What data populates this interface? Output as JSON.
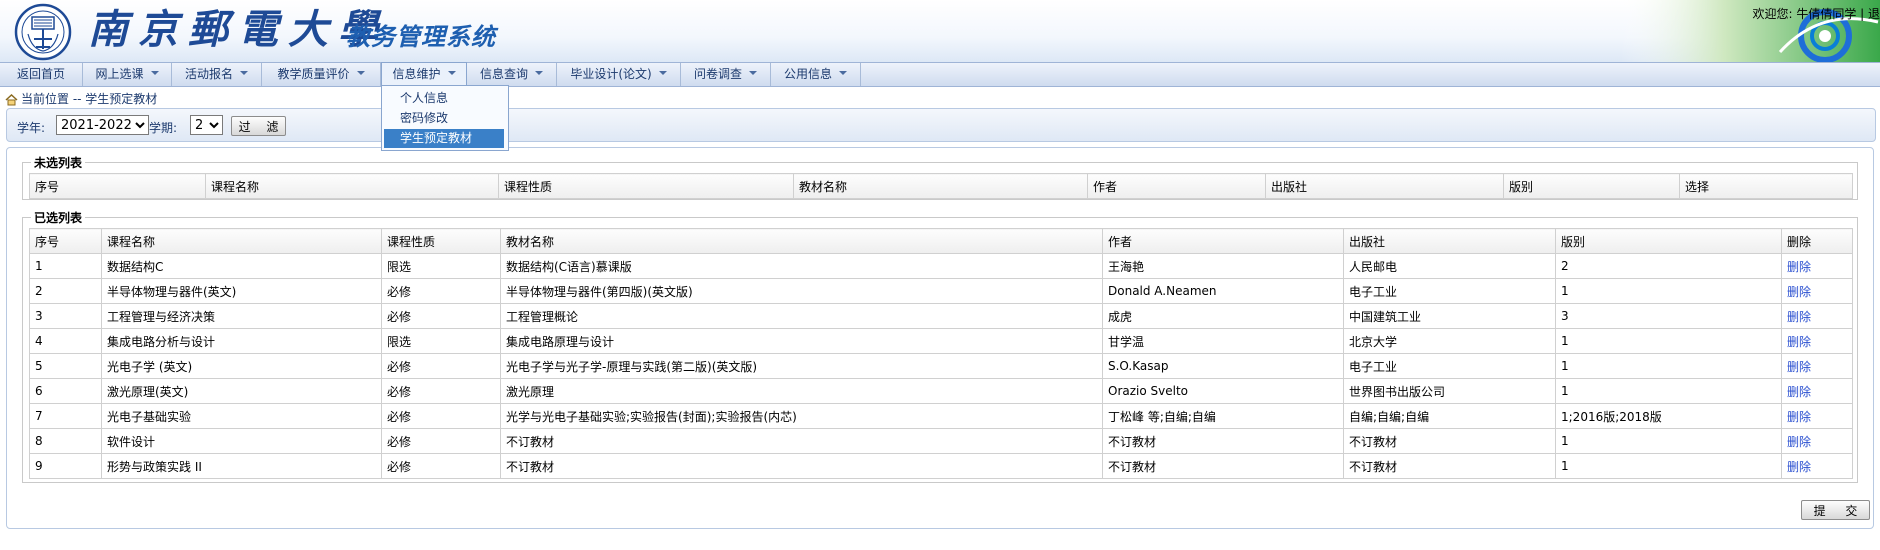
{
  "header": {
    "logo_text": "南京郵電大學",
    "school_name": "南京郵電大學",
    "system_name": "教务管理系统",
    "welcome": "欢迎您: 牛倩倩同学 | 退"
  },
  "nav": {
    "items": [
      {
        "label": "返回首页",
        "has_arrow": false
      },
      {
        "label": "网上选课",
        "has_arrow": true
      },
      {
        "label": "活动报名",
        "has_arrow": true
      },
      {
        "label": "教学质量评价",
        "has_arrow": true
      },
      {
        "label": "信息维护",
        "has_arrow": true,
        "active": true
      },
      {
        "label": "信息查询",
        "has_arrow": true
      },
      {
        "label": "毕业设计(论文)",
        "has_arrow": true
      },
      {
        "label": "问卷调查",
        "has_arrow": true
      },
      {
        "label": "公用信息",
        "has_arrow": true
      }
    ],
    "dropdown": [
      "个人信息",
      "密码修改",
      "学生预定教材"
    ],
    "dropdown_selected": 2
  },
  "breadcrumb": "当前位置 -- 学生预定教材",
  "filter": {
    "year_label": "学年:",
    "year_value": "2021-2022",
    "term_label": "学期:",
    "term_value": "2",
    "button": "过 滤"
  },
  "unselected": {
    "legend": "未选列表",
    "headers": [
      "序号",
      "课程名称",
      "课程性质",
      "教材名称",
      "作者",
      "出版社",
      "版别",
      "选择"
    ]
  },
  "selected": {
    "legend": "已选列表",
    "headers": [
      "序号",
      "课程名称",
      "课程性质",
      "教材名称",
      "作者",
      "出版社",
      "版别",
      "删除"
    ],
    "rows": [
      [
        "1",
        "数据结构C",
        "限选",
        "数据结构(C语言)慕课版",
        "王海艳",
        "人民邮电",
        "2",
        "删除"
      ],
      [
        "2",
        "半导体物理与器件(英文)",
        "必修",
        "半导体物理与器件(第四版)(英文版)",
        "Donald A.Neamen",
        "电子工业",
        "1",
        "删除"
      ],
      [
        "3",
        "工程管理与经济决策",
        "必修",
        "工程管理概论",
        "成虎",
        "中国建筑工业",
        "3",
        "删除"
      ],
      [
        "4",
        "集成电路分析与设计",
        "限选",
        "集成电路原理与设计",
        "甘学温",
        "北京大学",
        "1",
        "删除"
      ],
      [
        "5",
        "光电子学 (英文)",
        "必修",
        "光电子学与光子学-原理与实践(第二版)(英文版)",
        "S.O.Kasap",
        "电子工业",
        "1",
        "删除"
      ],
      [
        "6",
        "激光原理(英文)",
        "必修",
        "激光原理",
        "Orazio Svelto",
        "世界图书出版公司",
        "1",
        "删除"
      ],
      [
        "7",
        "光电子基础实验",
        "必修",
        "光学与光电子基础实验;实验报告(封面);实验报告(内芯)",
        "丁松峰 等;自编;自编",
        "自编;自编;自编",
        "1;2016版;2018版",
        "删除"
      ],
      [
        "8",
        "软件设计",
        "必修",
        "不订教材",
        "不订教材",
        "不订教材",
        "1",
        "删除"
      ],
      [
        "9",
        "形势与政策实践 II",
        "必修",
        "不订教材",
        "不订教材",
        "不订教材",
        "1",
        "删除"
      ]
    ]
  },
  "submit_button": "提 交",
  "colors": {
    "link": "#2a4fd0",
    "brand": "#1e4a96",
    "menu_selected": "#3a80c8"
  }
}
